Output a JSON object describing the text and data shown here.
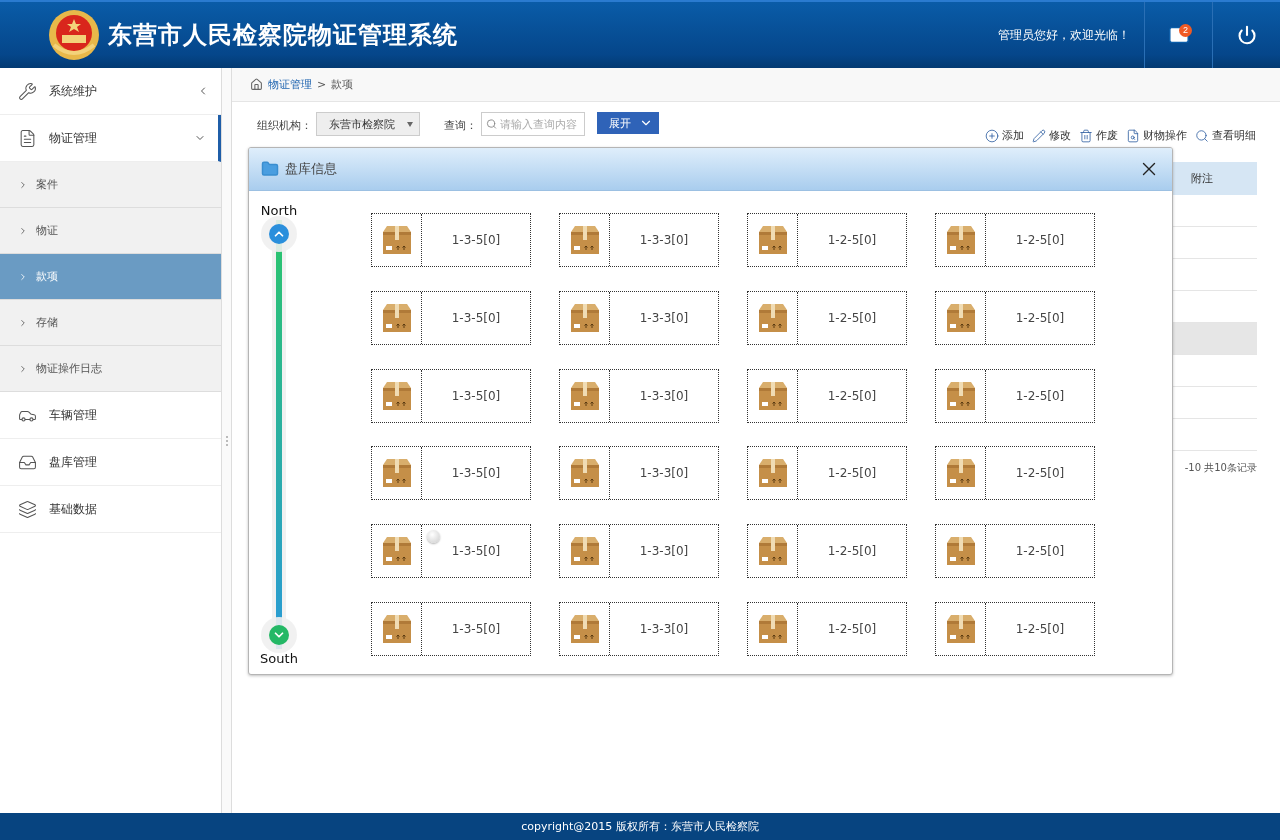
{
  "header": {
    "title": "东营市人民检察院物证管理系统",
    "greeting": "管理员您好，欢迎光临！",
    "mail_badge": "2"
  },
  "sidebar": {
    "items": [
      {
        "label": "系统维护",
        "expanded": false
      },
      {
        "label": "物证管理",
        "expanded": true,
        "children": [
          {
            "label": "案件",
            "selected": false
          },
          {
            "label": "物证",
            "selected": false
          },
          {
            "label": "款项",
            "selected": true
          },
          {
            "label": "存储",
            "selected": false
          },
          {
            "label": "物证操作日志",
            "selected": false
          }
        ]
      },
      {
        "label": "车辆管理"
      },
      {
        "label": "盘库管理"
      },
      {
        "label": "基础数据"
      }
    ]
  },
  "breadcrumb": {
    "parent": "物证管理",
    "separator": ">",
    "current": "款项"
  },
  "filters": {
    "org_label": "组织机构：",
    "org_value": "东营市检察院",
    "query_label": "查询：",
    "query_placeholder": "请输入查询内容",
    "expand_button": "展开"
  },
  "actions": [
    "添加",
    "修改",
    "作废",
    "财物操作",
    "查看明细"
  ],
  "table": {
    "columns": [
      "附注"
    ],
    "rows": [
      {
        "selected": false
      },
      {
        "selected": false
      },
      {
        "selected": false
      },
      {
        "selected": false
      },
      {
        "selected": true
      },
      {
        "selected": false
      },
      {
        "selected": false
      },
      {
        "selected": false
      }
    ],
    "pager": "-10 共10条记录"
  },
  "dialog": {
    "title": "盘库信息",
    "north": "North",
    "south": "South",
    "level": 1,
    "rows": [
      {
        "cells": [
          {
            "label": "1-3-5[0]",
            "pin": false
          },
          {
            "label": "1-3-3[0]",
            "pin": false
          },
          {
            "label": "1-2-5[0]",
            "pin": false
          },
          {
            "label": "1-2-5[0]",
            "pin": false
          }
        ]
      },
      {
        "cells": [
          {
            "label": "1-3-5[0]",
            "pin": false
          },
          {
            "label": "1-3-3[0]",
            "pin": false
          },
          {
            "label": "1-2-5[0]",
            "pin": false
          },
          {
            "label": "1-2-5[0]",
            "pin": false
          }
        ]
      },
      {
        "cells": [
          {
            "label": "1-3-5[0]",
            "pin": false
          },
          {
            "label": "1-3-3[0]",
            "pin": false
          },
          {
            "label": "1-2-5[0]",
            "pin": false
          },
          {
            "label": "1-2-5[0]",
            "pin": false
          }
        ]
      },
      {
        "cells": [
          {
            "label": "1-3-5[0]",
            "pin": false
          },
          {
            "label": "1-3-3[0]",
            "pin": false
          },
          {
            "label": "1-2-5[0]",
            "pin": false
          },
          {
            "label": "1-2-5[0]",
            "pin": false
          }
        ]
      },
      {
        "cells": [
          {
            "label": "1-3-5[0]",
            "pin": true
          },
          {
            "label": "1-3-3[0]",
            "pin": false
          },
          {
            "label": "1-2-5[0]",
            "pin": false
          },
          {
            "label": "1-2-5[0]",
            "pin": false
          }
        ]
      },
      {
        "cells": [
          {
            "label": "1-3-5[0]",
            "pin": false
          },
          {
            "label": "1-3-3[0]",
            "pin": false
          },
          {
            "label": "1-2-5[0]",
            "pin": false
          },
          {
            "label": "1-2-5[0]",
            "pin": false
          }
        ]
      }
    ]
  },
  "footer": {
    "text": "copyright@2015 版权所有：东营市人民检察院"
  }
}
